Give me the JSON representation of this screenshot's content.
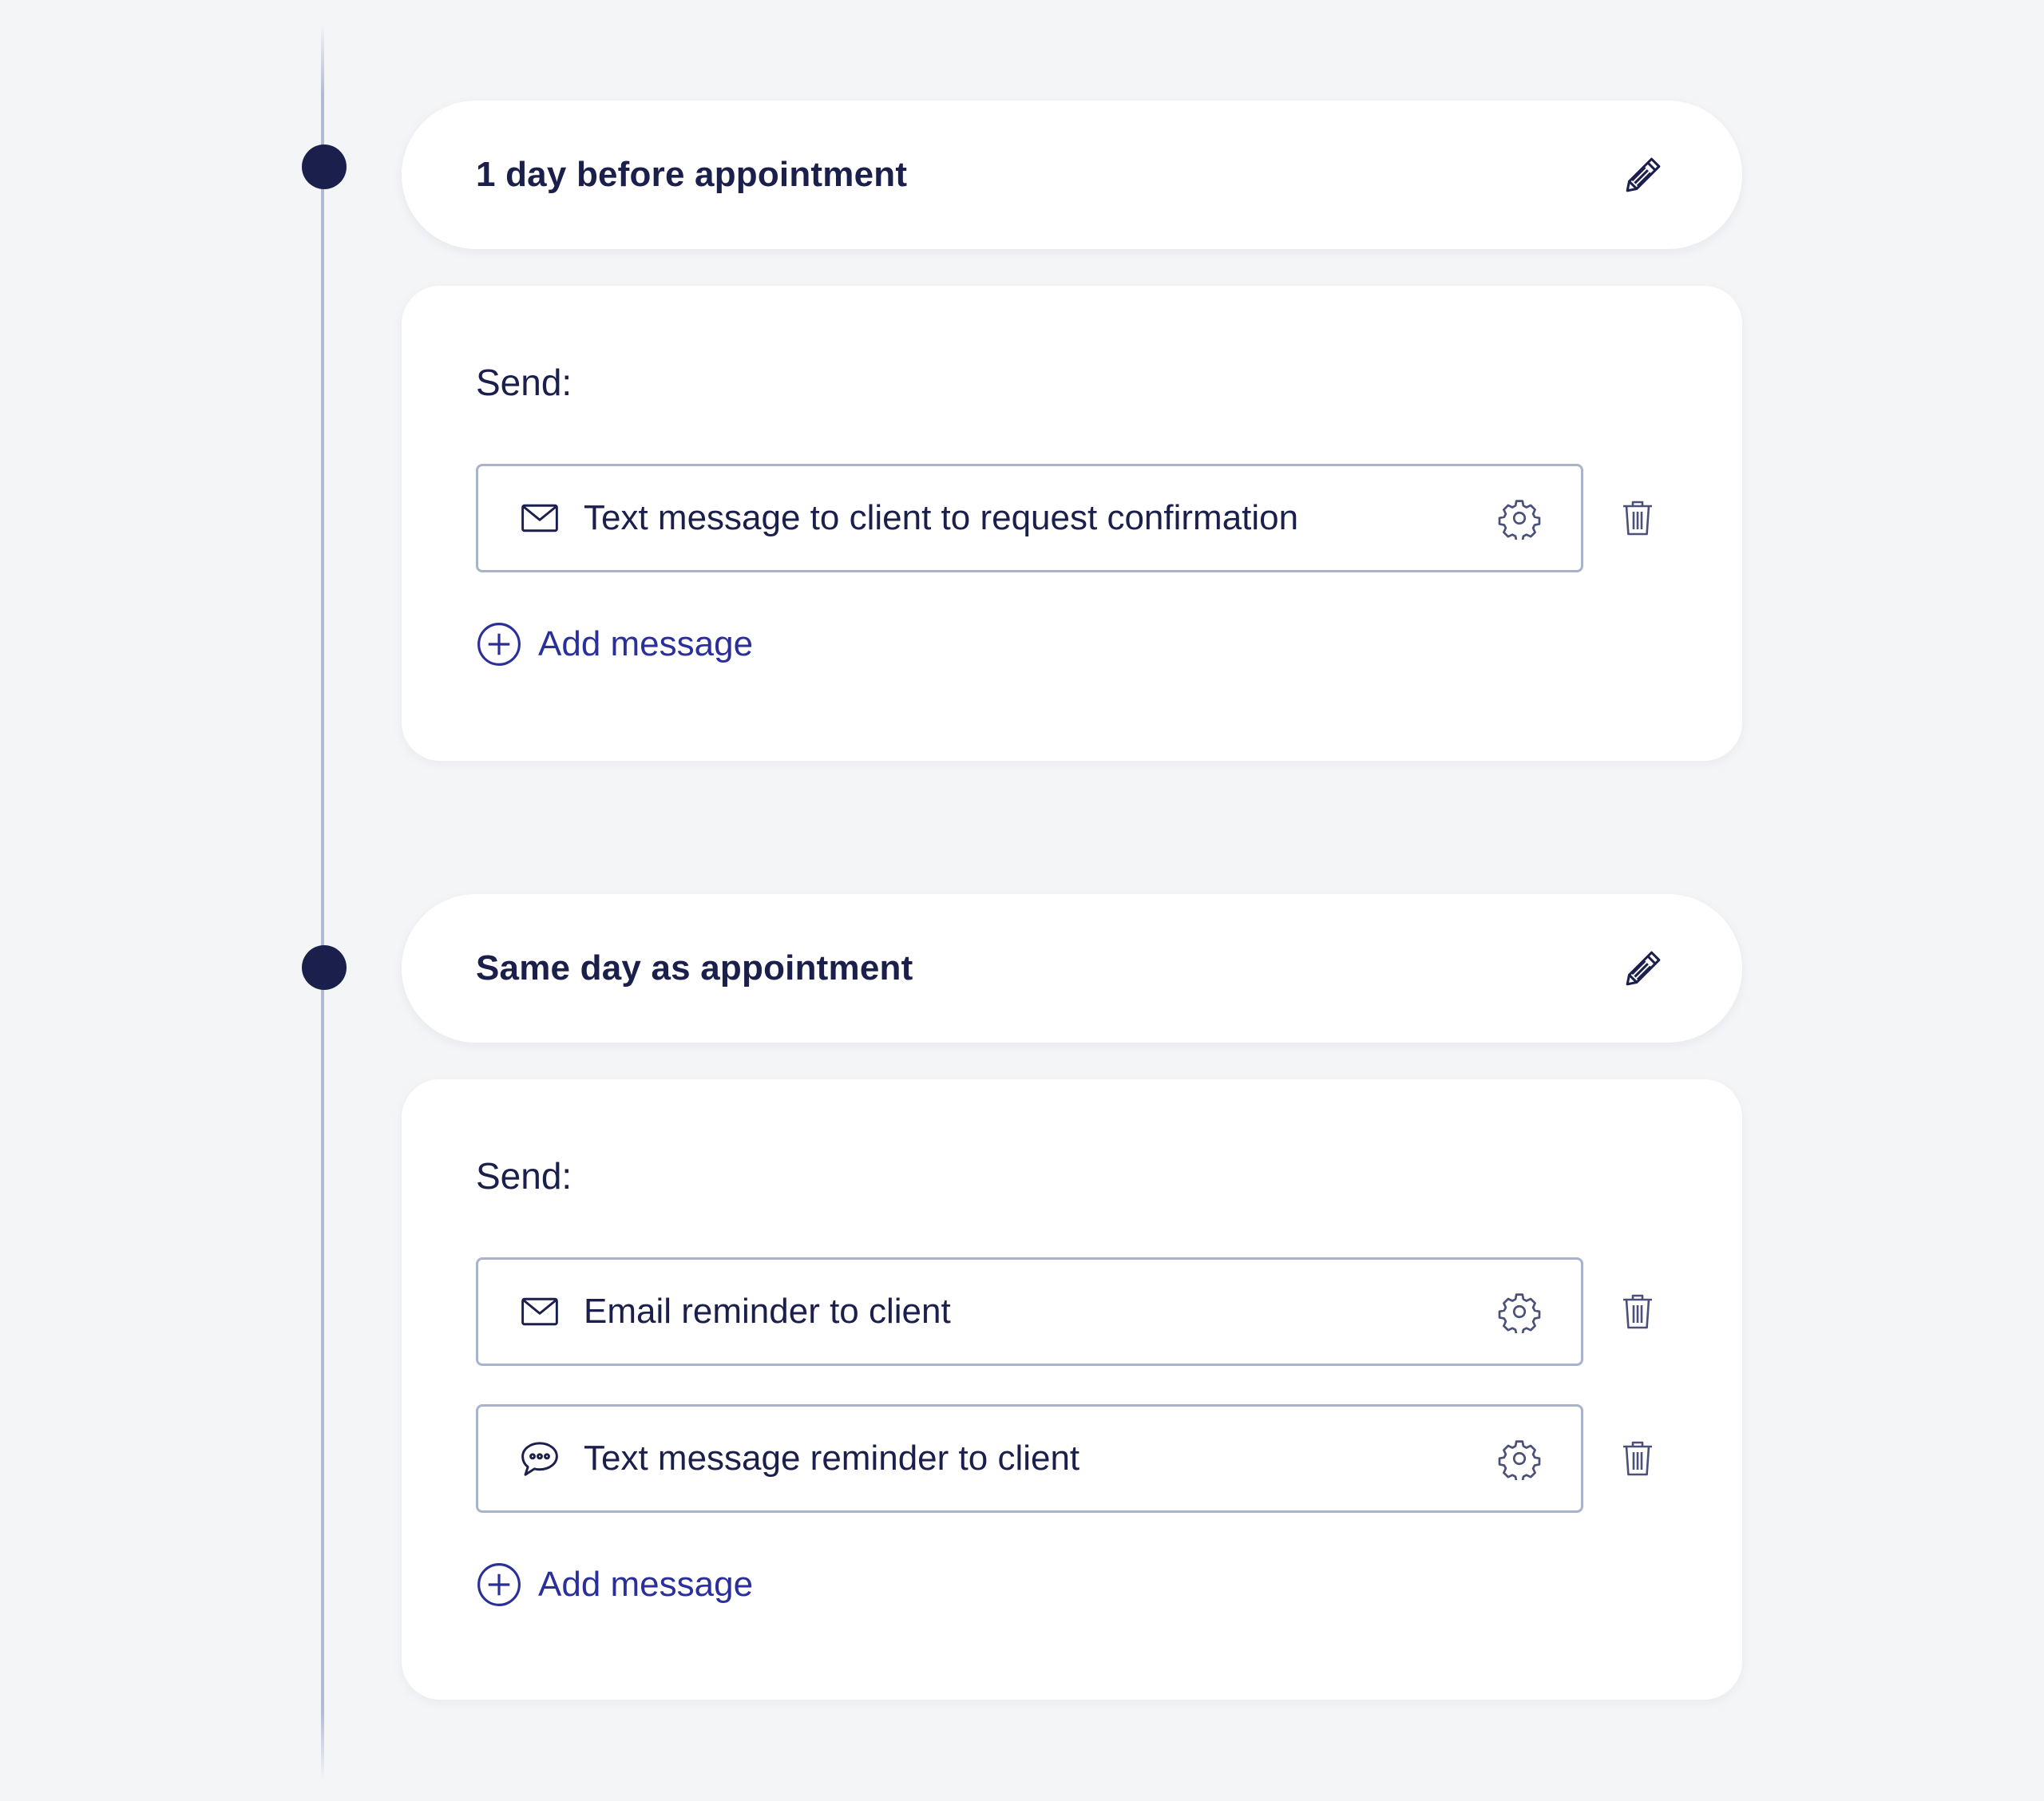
{
  "colors": {
    "background": "#f4f5f7",
    "text": "#1b1f4b",
    "accent": "#2b2f9a",
    "border": "#aab3cc",
    "timeline": "#b0bad2"
  },
  "groups": [
    {
      "title": "1 day before appointment",
      "send_label": "Send:",
      "messages": [
        {
          "icon": "envelope-icon",
          "text": "Text message to client to request confirmation"
        }
      ],
      "add_label": "Add message"
    },
    {
      "title": "Same day as appointment",
      "send_label": "Send:",
      "messages": [
        {
          "icon": "envelope-icon",
          "text": "Email reminder to client"
        },
        {
          "icon": "chat-bubble-icon",
          "text": "Text message reminder to client"
        }
      ],
      "add_label": "Add message"
    }
  ]
}
